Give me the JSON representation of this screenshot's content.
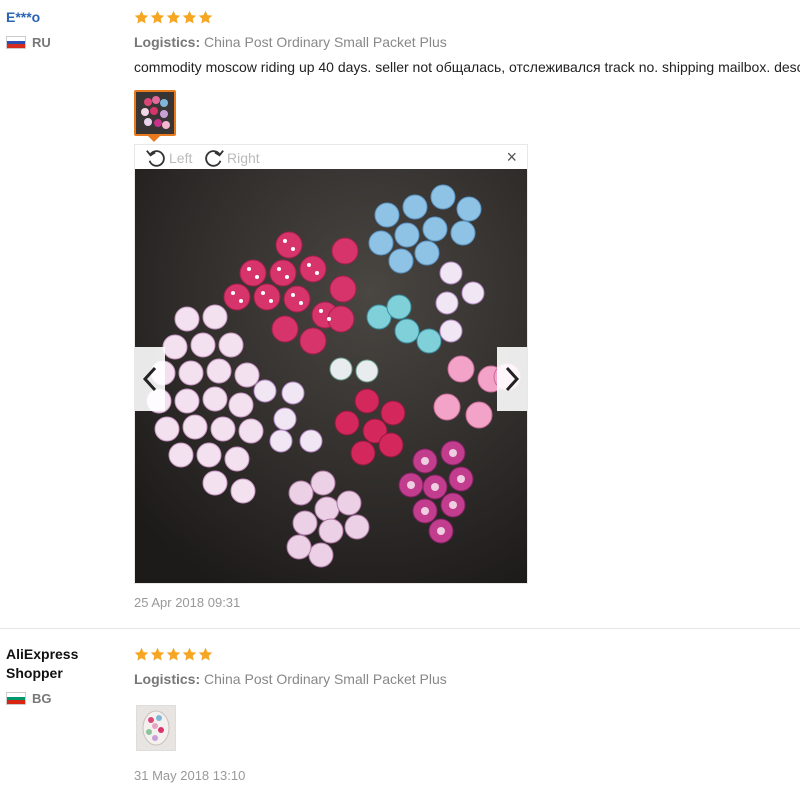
{
  "reviews": [
    {
      "user_name": "E***o",
      "country": "RU",
      "rating": 5,
      "logistics_label": "Logistics:",
      "logistics_value": "China Post Ordinary Small Packet Plus",
      "feedback": "commodity moscow riding up 40 days. seller not общалась, отслеживался track no. shipping mailbox. description",
      "viewer": {
        "rotate_left": "Left",
        "rotate_right": "Right",
        "close": "×"
      },
      "date": "25 Apr 2018 09:31"
    },
    {
      "user_name": "AliExpress Shopper",
      "country": "BG",
      "rating": 5,
      "logistics_label": "Logistics:",
      "logistics_value": "China Post Ordinary Small Packet Plus",
      "date": "31 May 2018 13:10"
    }
  ],
  "colors": {
    "star": "#f5a623",
    "username_link": "#2a64b5",
    "thumb_active_border": "#e8791c"
  },
  "icons": [
    "star-icon",
    "flag-ru-icon",
    "flag-bg-icon",
    "rotate-left-icon",
    "rotate-right-icon",
    "close-icon",
    "chevron-left-icon",
    "chevron-right-icon"
  ]
}
